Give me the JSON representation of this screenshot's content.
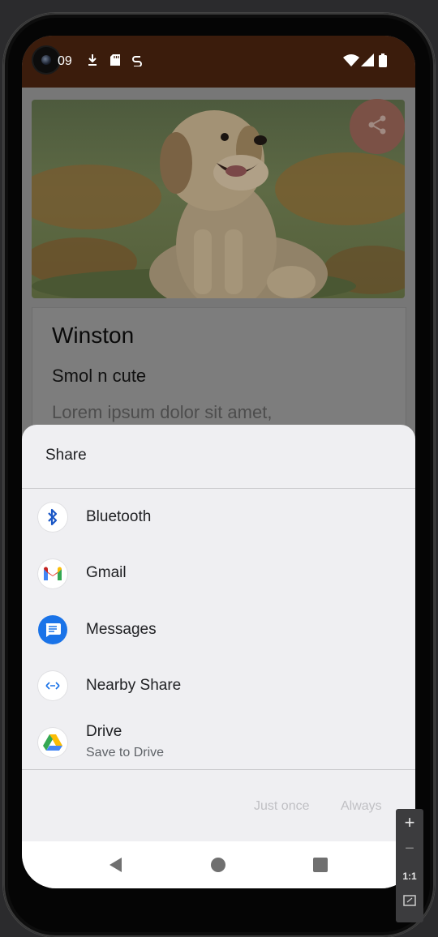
{
  "status_bar": {
    "time": "09",
    "icons": [
      "download-icon",
      "sd-card-icon",
      "sync-icon",
      "wifi-icon",
      "signal-icon",
      "battery-icon"
    ]
  },
  "card": {
    "title": "Winston",
    "subtitle": "Smol n cute",
    "body": "Lorem ipsum dolor sit amet,"
  },
  "share_sheet": {
    "title": "Share",
    "apps": [
      {
        "label": "Bluetooth",
        "icon": "bluetooth-icon"
      },
      {
        "label": "Gmail",
        "icon": "gmail-icon"
      },
      {
        "label": "Messages",
        "icon": "messages-icon"
      },
      {
        "label": "Nearby Share",
        "icon": "nearby-share-icon"
      },
      {
        "label": "Drive",
        "sublabel": "Save to Drive",
        "icon": "drive-icon"
      }
    ],
    "just_once_label": "Just once",
    "always_label": "Always"
  },
  "nav": {
    "icons": [
      "back-icon",
      "home-icon",
      "recents-icon"
    ]
  },
  "zoom_toolbar": {
    "zoom_in": "+",
    "zoom_out": "−",
    "actual_size": "1:1"
  },
  "colors": {
    "status_bar": "#3b1c0c",
    "scrim_content": "#777777",
    "sheet_bg": "#efeff2",
    "fab": "#7b5146"
  }
}
